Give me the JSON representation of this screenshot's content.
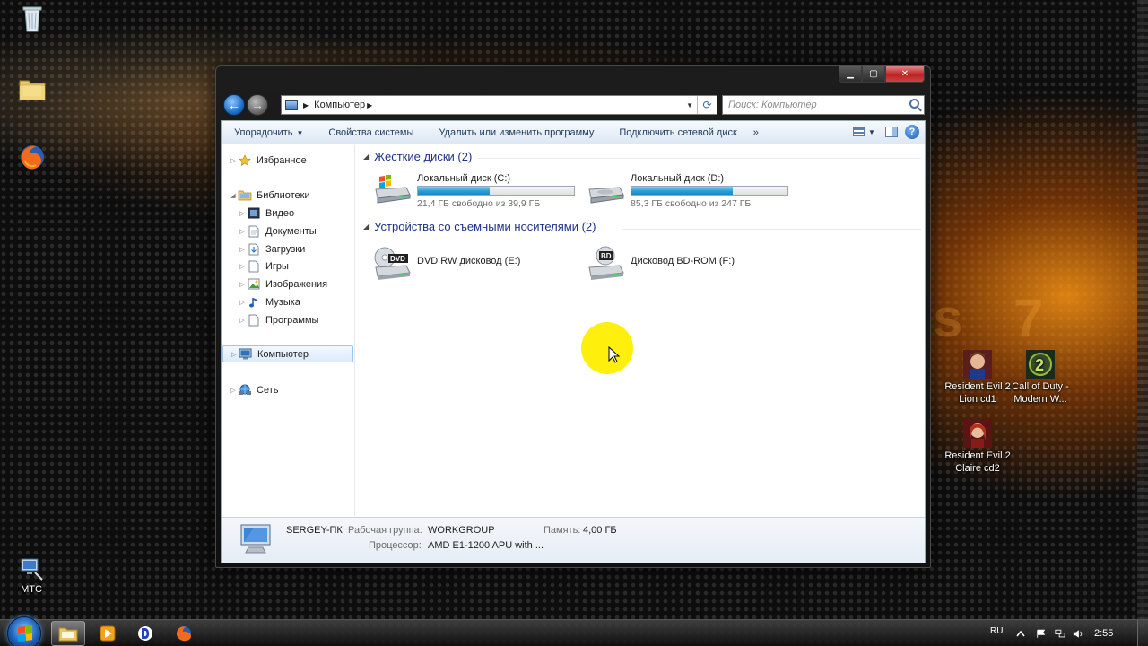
{
  "desktop": {
    "icons": [
      {
        "label": ""
      },
      {
        "label": ""
      },
      {
        "label": ""
      },
      {
        "label": "МТС"
      },
      {
        "label": "Resident Evil 2 Lion cd1"
      },
      {
        "label": "Call of Duty - Modern W..."
      },
      {
        "label": "Resident Evil 2 Claire cd2"
      }
    ]
  },
  "window": {
    "address": {
      "segment": "Компьютер"
    },
    "search": {
      "placeholder": "Поиск: Компьютер"
    },
    "toolbar": {
      "organize": "Упорядочить",
      "system_properties": "Свойства системы",
      "uninstall": "Удалить или изменить программу",
      "map_drive": "Подключить сетевой диск",
      "more": "»"
    },
    "nav": {
      "favorites": "Избранное",
      "libraries": "Библиотеки",
      "video": "Видео",
      "documents": "Документы",
      "downloads": "Загрузки",
      "games": "Игры",
      "images": "Изображения",
      "music": "Музыка",
      "programs": "Программы",
      "computer": "Компьютер",
      "network": "Сеть"
    },
    "groups": {
      "hard_disks": "Жесткие диски (2)",
      "removable": "Устройства со съемными носителями (2)"
    },
    "drives": [
      {
        "name": "Локальный диск (C:)",
        "free": "21,4 ГБ свободно из 39,9 ГБ",
        "used_fraction": 0.46
      },
      {
        "name": "Локальный диск (D:)",
        "free": "85,3 ГБ свободно из 247 ГБ",
        "used_fraction": 0.65
      }
    ],
    "removable": [
      {
        "name": "DVD RW дисковод (E:)",
        "badge": "DVD"
      },
      {
        "name": "Дисковод BD-ROM (F:)",
        "badge": "BD"
      }
    ],
    "details": {
      "computer_name": "SERGEY-ПК",
      "workgroup_label": "Рабочая группа:",
      "workgroup": "WORKGROUP",
      "memory_label": "Память:",
      "memory": "4,00 ГБ",
      "cpu_label": "Процессор:",
      "cpu": "AMD E1-1200 APU with ..."
    }
  },
  "taskbar": {
    "lang": "RU",
    "clock": "2:55"
  },
  "colors": {
    "bar_fill": "#2a9ed8",
    "group_header": "#1e3287",
    "selection": "#dbeafb"
  }
}
